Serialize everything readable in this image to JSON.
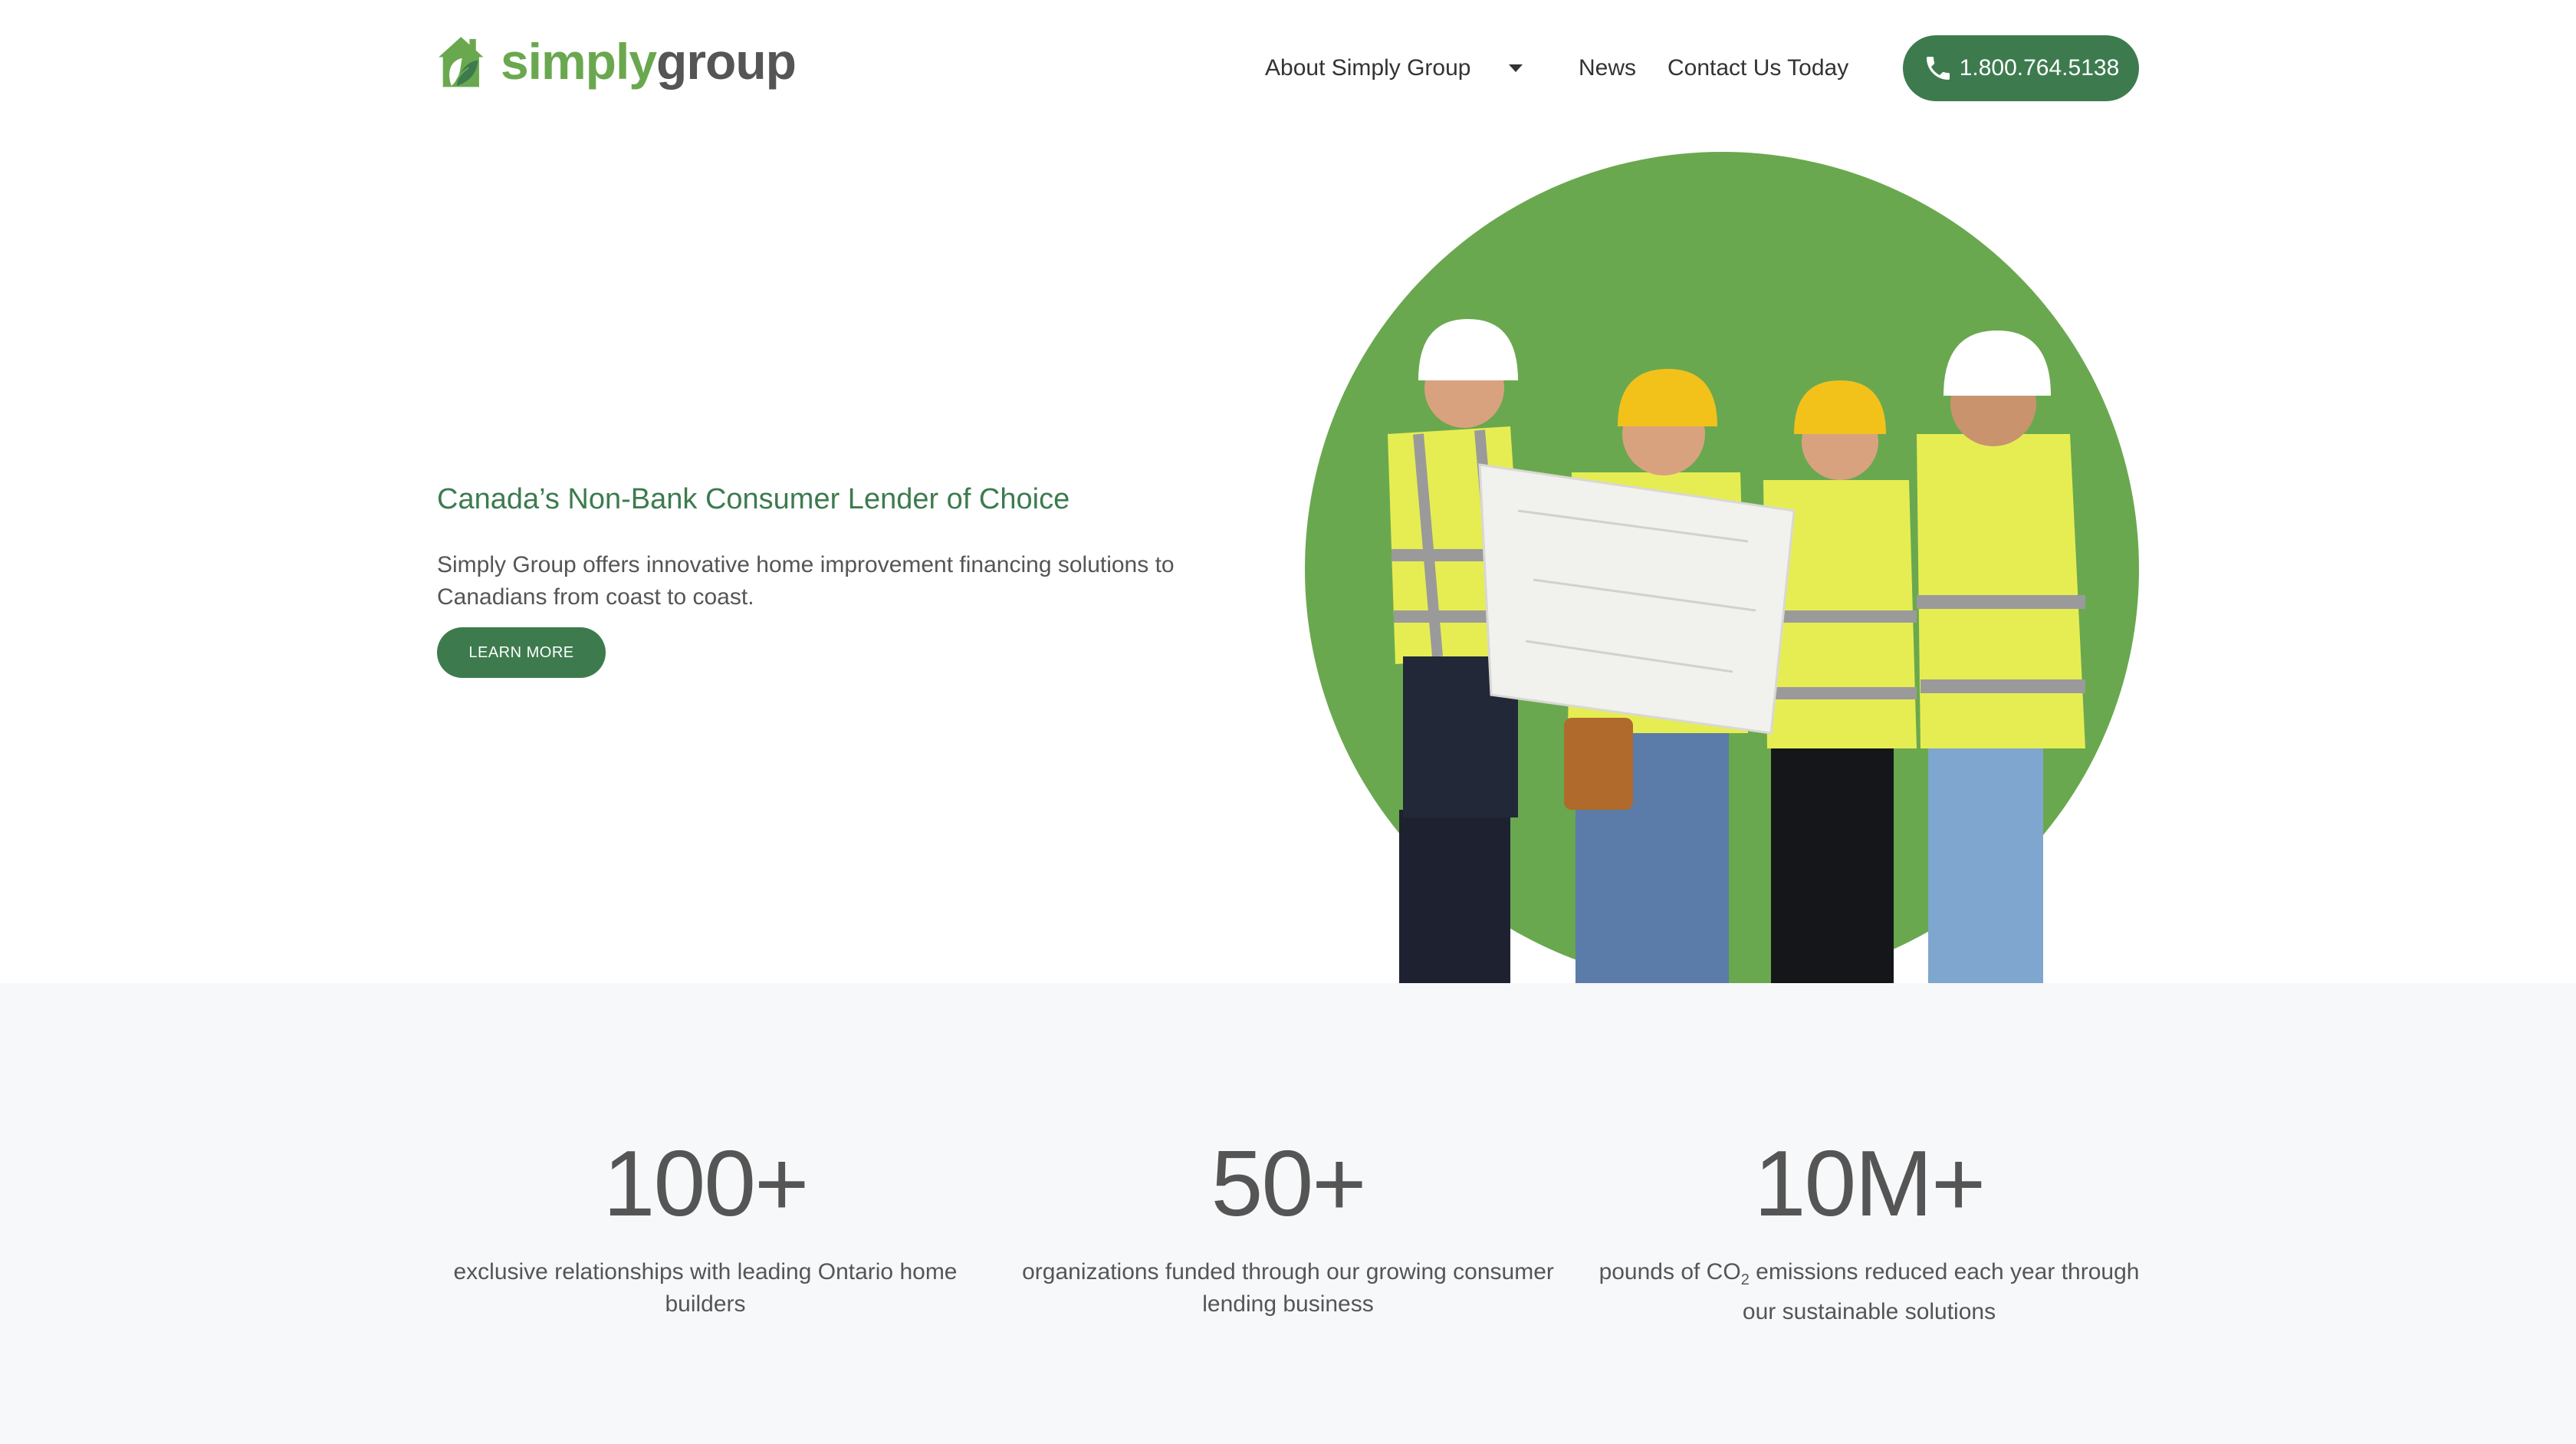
{
  "brand": {
    "name_part1": "simply",
    "name_part2": "group",
    "color_primary": "#3d7b4f",
    "color_light": "#6aa84f"
  },
  "nav": {
    "about": "About Simply Group",
    "news": "News",
    "contact": "Contact Us Today",
    "phone": "1.800.764.5138"
  },
  "hero": {
    "title": "Canada’s Non-Bank Consumer Lender of Choice",
    "text": "Simply Group offers innovative home improvement financing solutions to Canadians from coast to coast.",
    "cta": "LEARN MORE"
  },
  "stats": [
    {
      "value": "100+",
      "desc": "exclusive relationships with leading Ontario home builders"
    },
    {
      "value": "50+",
      "desc": "organizations funded through our growing consumer lending business"
    },
    {
      "value": "10M+",
      "desc_before": "pounds of CO",
      "desc_sub": "2",
      "desc_after": " emissions reduced each year through our sustainable solutions"
    }
  ]
}
